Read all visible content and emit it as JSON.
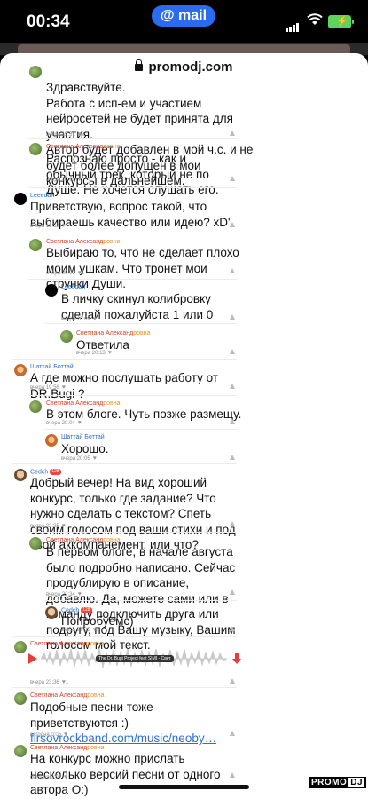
{
  "status_bar": {
    "time": "00:34",
    "app_pill": "@ mail"
  },
  "browser": {
    "url": "promodj.com"
  },
  "comments": [
    {
      "id": "c0",
      "author": "",
      "text": "Здравствуйте.\nРабота с исп-ем и участием нейросетей не будет принята для участия.\nАвтор будет добавлен в мой ч.с. и не будет более допущен в мои конкурсы в дальнейшем.",
      "time": "вчера 19:51",
      "likes": "2"
    },
    {
      "id": "c1",
      "author_a": "Светлана Александ",
      "author_b": "ровна",
      "text": "Распознаю просто - как и обычный трек, который не по Душе. Не хочется слушать его.",
      "time": "вчера 20:09"
    },
    {
      "id": "c2",
      "author": "Leeedah",
      "text": "Приветствую, вопрос такой, что выбираешь качество или идею? xD'",
      "time": "вчера 19:52"
    },
    {
      "id": "c3",
      "author_a": "Светлана Александ",
      "author_b": "ровна",
      "text": "Выбираю то, что не сделает плохо моим ушкам. Что тронет мои струнки Души.",
      "time": "вчера 20:02",
      "likes": "1"
    },
    {
      "id": "c4",
      "author": "Leeedah",
      "text": "В личку скинул колибровку сделай пожалуйста 1 или 0",
      "time": "вчера 20:09"
    },
    {
      "id": "c5",
      "author_a": "Светлана Александ",
      "author_b": "ровна",
      "text": "Ответила",
      "time": "вчера 20:13"
    },
    {
      "id": "c6",
      "author": "Шаттай Боттай",
      "text": "А где можно послушать работу от DR.Bugi ?",
      "time": "вчера 19:56"
    },
    {
      "id": "c7",
      "author_a": "Светлана Александ",
      "author_b": "ровна",
      "text": "В этом блоге. Чуть позже размещу.",
      "time": "вчера 20:04"
    },
    {
      "id": "c8",
      "author": "Шаттай Боттай",
      "text": "Хорошо.",
      "time": "вчера 20:05"
    },
    {
      "id": "c9",
      "author": "Cedch",
      "badge": "128",
      "text": "Добрый вечер! На вид хороший конкурс, только где задание? Что нужно сделать с текстом? Спеть своим голосом под ваши стихи и под свой аккомпанемент, или что?",
      "time": "вчера 22:25"
    },
    {
      "id": "c10",
      "author_a": "Светлана Александ",
      "author_b": "ровна",
      "text": "В первом блоге, в начале августа было подробно написано. Сейчас продублирую в описание, добавлю. Да, можете сами или в команду подключить друга или подругу, под Вашу музыку, Вашим голосом мой текст.",
      "time": "вчера 22:34"
    },
    {
      "id": "c11",
      "author": "Cedch",
      "badge": "128",
      "text": "Попробуемс)",
      "time": "вчера 22:35",
      "likes": "1"
    },
    {
      "id": "c12",
      "author_a": "Светлана Александ",
      "author_b": "ровна",
      "track": "The Dr. Bugi Project feat SIMI - Свет",
      "time": "вчера 23:36",
      "likes": "1"
    },
    {
      "id": "c13",
      "author_a": "Светлана Александ",
      "author_b": "ровна",
      "text": "Подобные песни тоже приветствуются :)",
      "link": "firsovrockband.com/music/neoby…",
      "time": "сегодня 0:05"
    },
    {
      "id": "c14",
      "author_a": "Светлана Александ",
      "author_b": "ровна",
      "text": "На конкурс можно прислать несколько версий песни от одного автора О:)",
      "time": "сегодня 0:07"
    }
  ],
  "logo": {
    "promo": "PROMO",
    "dj": "DJ"
  },
  "colors": {
    "accent_blue": "#2a6cf0",
    "author_red": "#d2452b",
    "author_orange": "#e69225",
    "author_blue": "#2f6fd0",
    "play_red": "#e1403a"
  }
}
